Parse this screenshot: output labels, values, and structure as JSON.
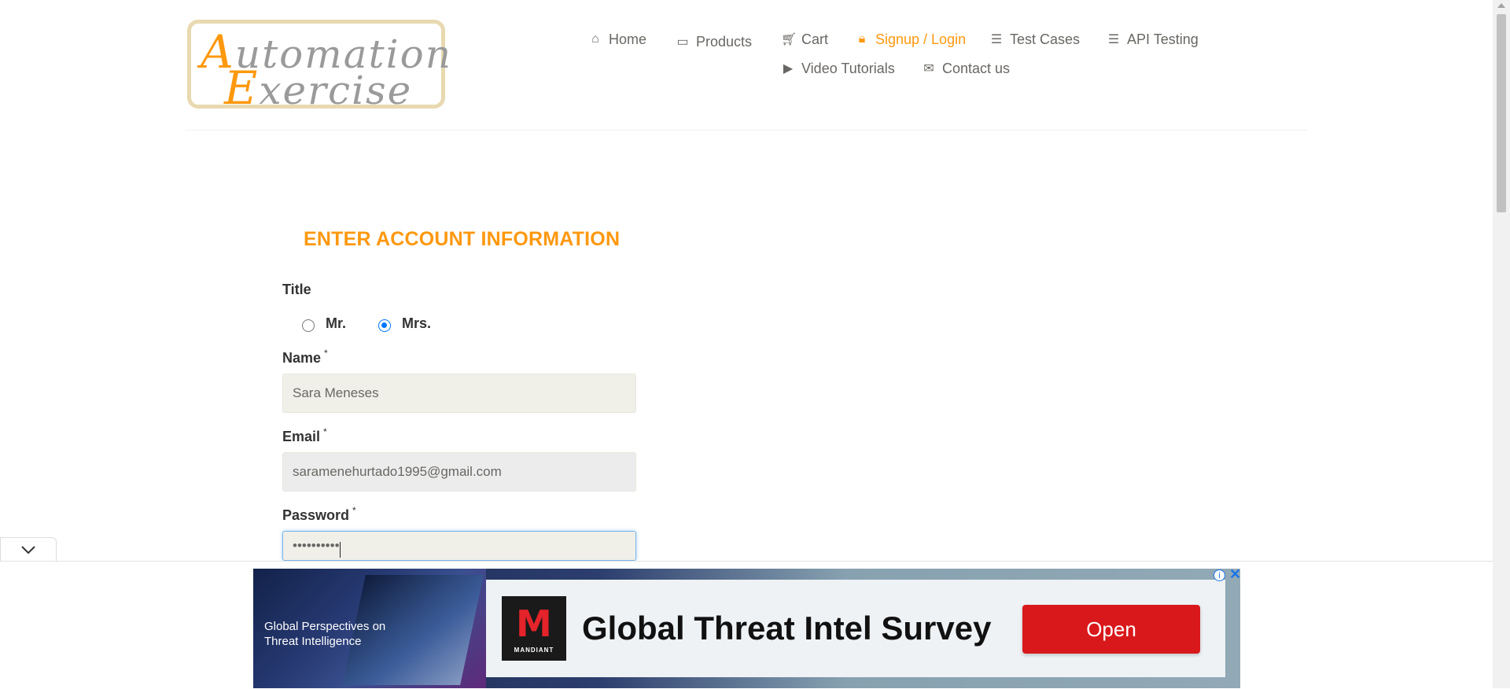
{
  "logo": {
    "text": "Automation Exercise",
    "line1": "utomation",
    "line2": "xercise",
    "cap1": "A",
    "cap2": "E"
  },
  "nav": {
    "home": {
      "icon": "home-icon",
      "label": "Home"
    },
    "products": {
      "icon": "briefcase-icon",
      "label": "Products"
    },
    "cart": {
      "icon": "cart-icon",
      "label": "Cart"
    },
    "signup": {
      "icon": "lock-icon",
      "label": "Signup / Login"
    },
    "testcases": {
      "icon": "list-icon",
      "label": "Test Cases"
    },
    "api": {
      "icon": "list-icon",
      "label": "API Testing"
    },
    "videos": {
      "icon": "youtube-icon",
      "label": "Video Tutorials"
    },
    "contact": {
      "icon": "envelope-icon",
      "label": "Contact us"
    }
  },
  "form": {
    "heading": "ENTER ACCOUNT INFORMATION",
    "title_label": "Title",
    "title_options": [
      {
        "label": "Mr.",
        "checked": false
      },
      {
        "label": "Mrs.",
        "checked": true
      }
    ],
    "name_label": "Name",
    "name_value": "Sara Meneses",
    "email_label": "Email",
    "email_value": "saramenehurtado1995@gmail.com",
    "password_label": "Password",
    "password_value": "••••••••••",
    "required_mark": "*"
  },
  "ad": {
    "side_copy": "Global Perspectives on Threat Intelligence",
    "brand": "MANDIANT",
    "brand_letter": "M",
    "headline": "Global Threat Intel Survey",
    "cta": "Open",
    "info_icon": "i",
    "close_icon": "✕"
  },
  "colors": {
    "accent": "#fe980f",
    "cta": "#d9181b",
    "radio": "#0075ff"
  }
}
